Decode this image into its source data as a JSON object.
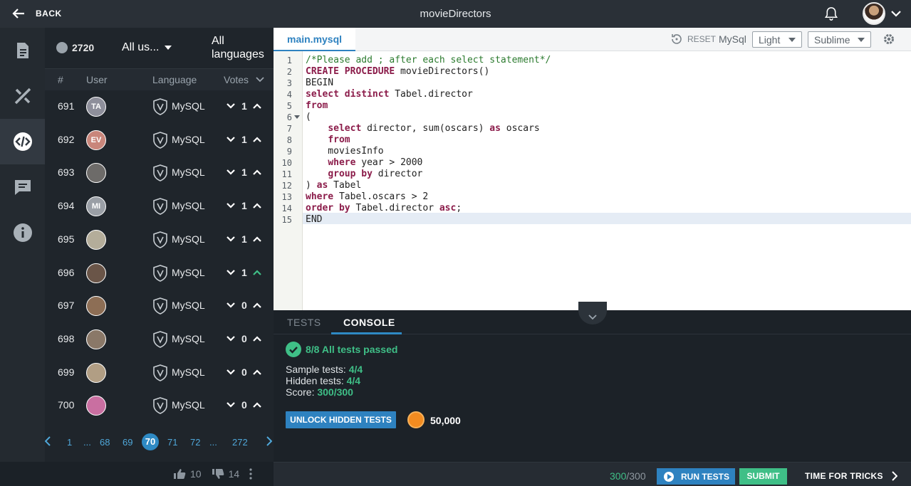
{
  "topbar": {
    "back_label": "BACK",
    "title": "movieDirectors"
  },
  "rail": {
    "items": [
      "description-icon",
      "tools-icon",
      "solutions-icon",
      "comments-icon",
      "info-icon"
    ]
  },
  "list": {
    "solutions_count": "2720",
    "users_filter": "All us...",
    "languages_filter": "All languages",
    "columns": {
      "num": "#",
      "user": "User",
      "language": "Language",
      "votes": "Votes"
    },
    "rows": [
      {
        "num": "691",
        "initials": "TA",
        "avatar_color": "#8e8f9b",
        "language": "MySQL",
        "votes": "1"
      },
      {
        "num": "692",
        "initials": "EV",
        "avatar_color": "#c9867b",
        "language": "MySQL",
        "votes": "1"
      },
      {
        "num": "693",
        "initials": "",
        "avatar_color": "#6d6b69",
        "language": "MySQL",
        "votes": "1"
      },
      {
        "num": "694",
        "initials": "MI",
        "avatar_color": "#9a9fa6",
        "language": "MySQL",
        "votes": "1"
      },
      {
        "num": "695",
        "initials": "",
        "avatar_color": "#b4ad9a",
        "language": "MySQL",
        "votes": "1"
      },
      {
        "num": "696",
        "initials": "",
        "avatar_color": "#6a5548",
        "language": "MySQL",
        "votes": "1"
      },
      {
        "num": "697",
        "initials": "",
        "avatar_color": "#8d6e55",
        "language": "MySQL",
        "votes": "0"
      },
      {
        "num": "698",
        "initials": "",
        "avatar_color": "#8a7868",
        "language": "MySQL",
        "votes": "0"
      },
      {
        "num": "699",
        "initials": "",
        "avatar_color": "#b19e84",
        "language": "MySQL",
        "votes": "0"
      },
      {
        "num": "700",
        "initials": "",
        "avatar_color": "#c96fa1",
        "language": "MySQL",
        "votes": "0"
      }
    ],
    "pager": [
      "1",
      "...",
      "68",
      "69",
      "70",
      "71",
      "72",
      "...",
      "272"
    ],
    "current_page": "70",
    "likes": "10",
    "dislikes": "14"
  },
  "editor": {
    "file_tab": "main.mysql",
    "reset_label": "RESET",
    "language": "MySql",
    "theme": "Light",
    "keymap": "Sublime",
    "line_numbers": [
      "1",
      "2",
      "3",
      "4",
      "5",
      "6",
      "7",
      "8",
      "9",
      "10",
      "11",
      "12",
      "13",
      "14",
      "15"
    ]
  },
  "console": {
    "tabs": [
      "TESTS",
      "CONSOLE"
    ],
    "passed": "8/8 All tests passed",
    "sample_label": "Sample tests:",
    "sample_value": "4/4",
    "hidden_label": "Hidden tests:",
    "hidden_value": "4/4",
    "score_label": "Score:",
    "score_value": "300/300",
    "unlock_label": "UNLOCK HIDDEN TESTS",
    "coins": "50,000"
  },
  "bottombar": {
    "score": "300",
    "score_total": "/300",
    "run_label": "RUN TESTS",
    "submit_label": "SUBMIT",
    "tricks_label": "TIME FOR TRICKS"
  },
  "colors": {
    "accent_blue": "#2e82c0",
    "success_green": "#3fbf87"
  }
}
